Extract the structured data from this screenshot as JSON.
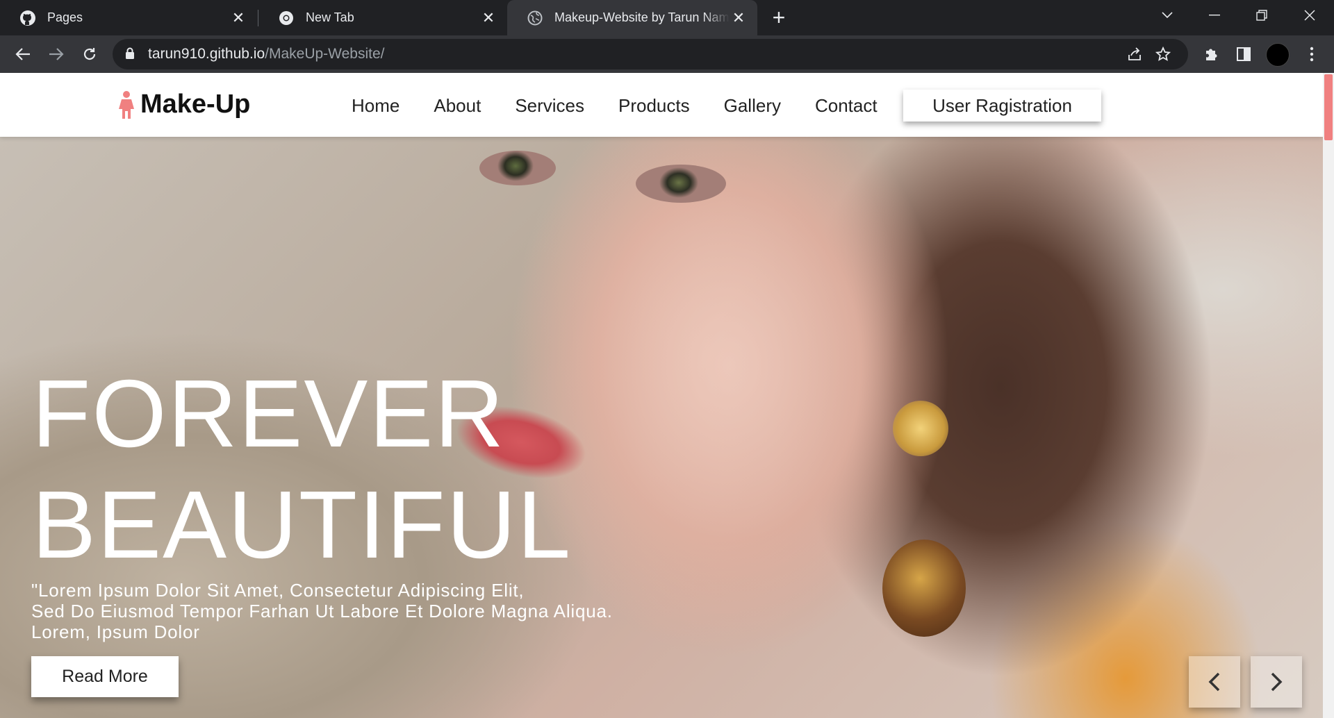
{
  "browser": {
    "tabs": [
      {
        "title": "Pages",
        "icon": "github-icon"
      },
      {
        "title": "New Tab",
        "icon": "chrome-icon"
      },
      {
        "title": "Makeup-Website by Tarun Namdev",
        "icon": "globe-icon",
        "active": true
      }
    ],
    "url_host": "tarun910.github.io",
    "url_path": "/MakeUp-Website/"
  },
  "site": {
    "brand": "Make-Up",
    "nav": [
      "Home",
      "About",
      "Services",
      "Products",
      "Gallery",
      "Contact"
    ],
    "register_label": "User Ragistration"
  },
  "hero": {
    "headline_1": "FOREVER",
    "headline_2": "BEAUTIFUL",
    "lead_lines": [
      "\"Lorem Ipsum Dolor Sit Amet, Consectetur Adipiscing Elit,",
      "Sed Do Eiusmod Tempor Farhan Ut Labore Et Dolore Magna Aliqua.",
      "Lorem, Ipsum Dolor"
    ],
    "read_more_label": "Read More"
  },
  "colors": {
    "brand_accent": "#f08080",
    "tab_strip": "#202124",
    "toolbar": "#35363a"
  }
}
